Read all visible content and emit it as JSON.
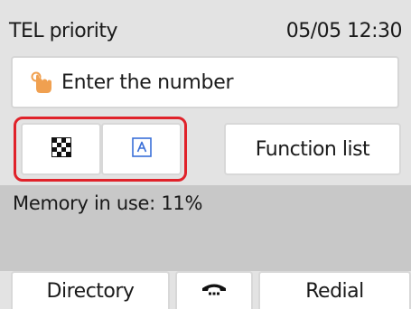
{
  "header": {
    "mode": "TEL priority",
    "datetime": "05/05 12:30"
  },
  "entry": {
    "placeholder": "Enter the number",
    "icon": "touch-hand-icon"
  },
  "scan_settings": {
    "resolution_icon": "resolution-icon",
    "scan_contrast_icon": "scan-contrast-icon"
  },
  "function_button": {
    "label": "Function list"
  },
  "status": {
    "memory_label": "Memory in use: 11%"
  },
  "bottom": {
    "directory_label": "Directory",
    "hook_icon": "on-hook-dial-icon",
    "redial_label": "Redial"
  },
  "colors": {
    "highlight": "#e0222a",
    "screen_bg": "#e3e3e3",
    "status_bg": "#c8c8c8",
    "icon_accent": "#3a6fd8",
    "touch_icon": "#f0a050"
  }
}
